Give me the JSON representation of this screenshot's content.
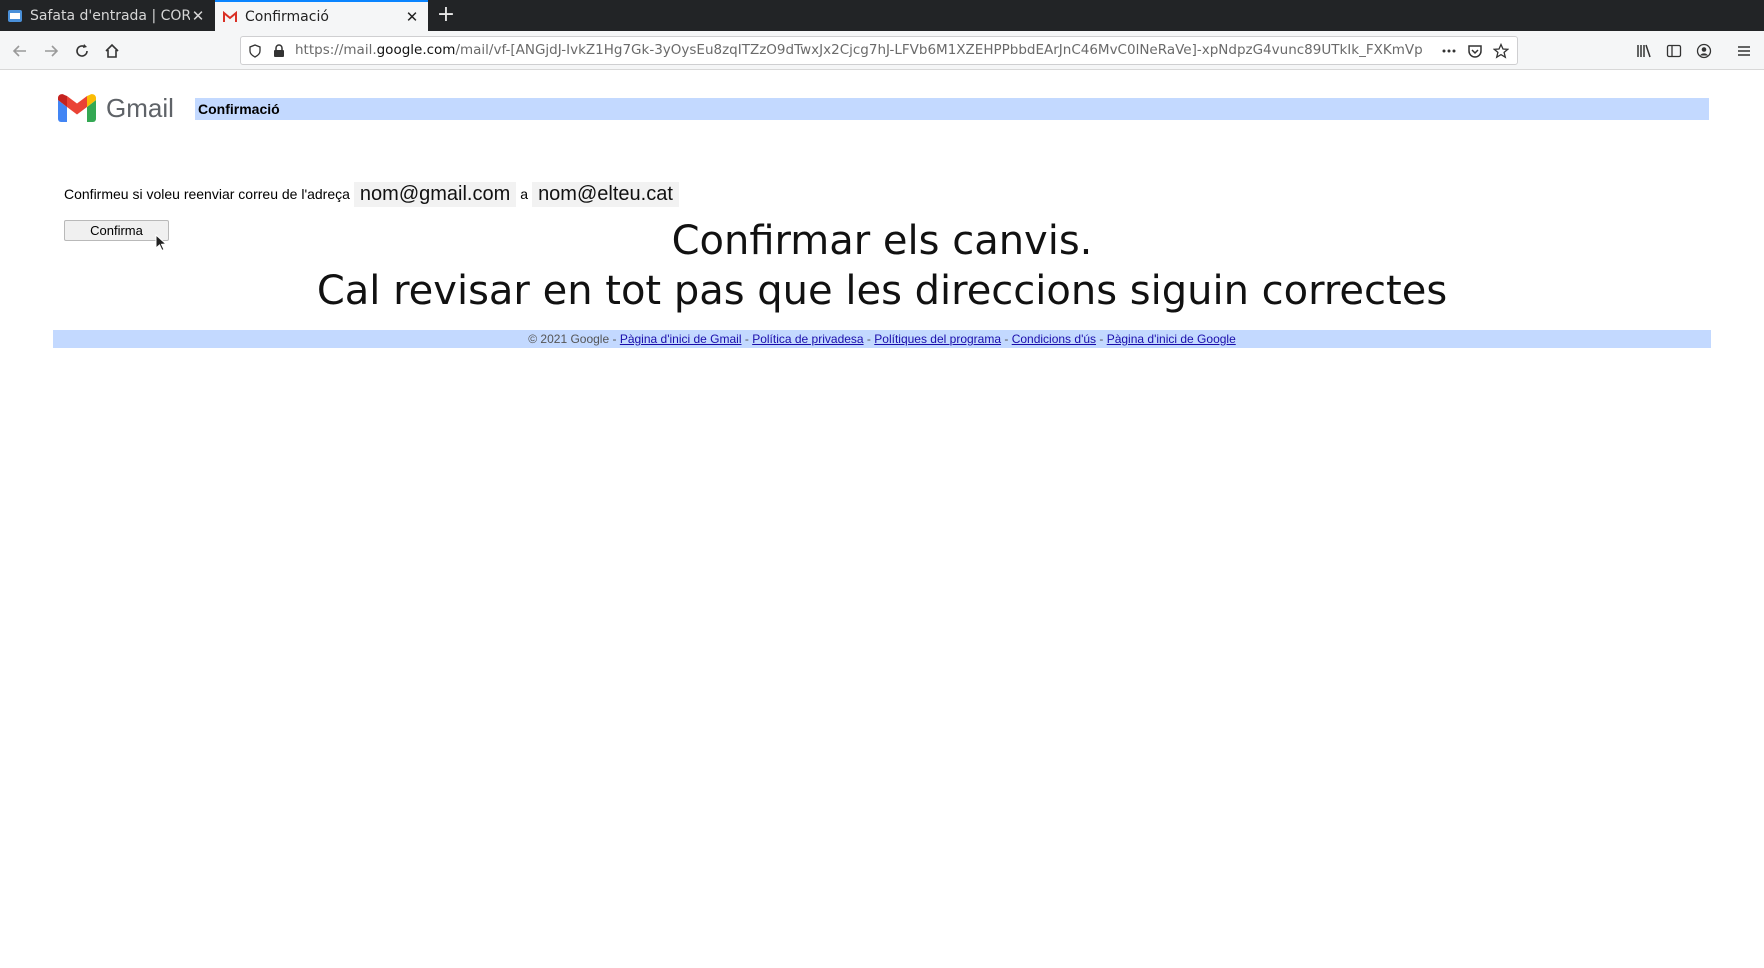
{
  "browser": {
    "tabs": [
      {
        "label": "Safata d'entrada | CORE",
        "active": false
      },
      {
        "label": "Confirmació",
        "active": true
      }
    ],
    "url": {
      "prefix": "https://mail.",
      "host": "google.com",
      "rest": "/mail/vf-[ANGjdJ-IvkZ1Hg7Gk-3yOysEu8zqITZzO9dTwxJx2Cjcg7hJ-LFVb6M1XZEHPPbbdEArJnC46MvC0lNeRaVe]-xpNdpzG4vunc89UTkIk_FXKmVp"
    }
  },
  "page": {
    "logo_text": "Gmail",
    "title": "Confirmació",
    "message_prefix": "Confirmeu si voleu reenviar correu de l'adreça",
    "from_address": "nom@gmail.com",
    "connector": "a",
    "to_address": "nom@elteu.cat",
    "confirm_label": "Confirma"
  },
  "overlay": {
    "line1": "Confirmar els canvis.",
    "line2": "Cal revisar en tot pas que les direccions siguin correctes"
  },
  "footer": {
    "copyright": "© 2021 Google",
    "links": [
      "Pàgina d'inici de Gmail",
      "Política de privadesa",
      "Polítiques del programa",
      "Condicions d'ús",
      "Pàgina d'inici de Google"
    ]
  },
  "colors": {
    "titlebar_bg": "#c3d9ff",
    "link": "#1a0dab",
    "tab_accent": "#0a84ff"
  }
}
